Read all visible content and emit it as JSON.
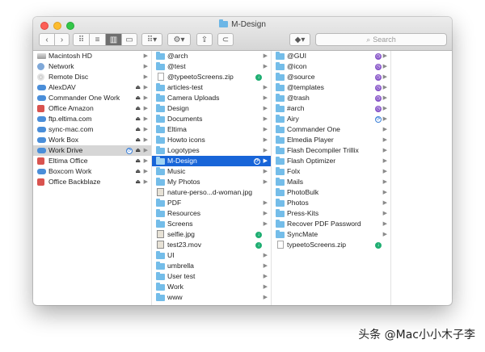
{
  "window": {
    "title": "M-Design"
  },
  "toolbar": {
    "back_icon": "chevron-left-icon",
    "forward_icon": "chevron-right-icon",
    "view_icons": [
      "icon-view-icon",
      "list-view-icon",
      "column-view-icon",
      "cover-flow-icon"
    ],
    "active_view": "column-view-icon",
    "search_placeholder": "Search"
  },
  "columns": {
    "sidebar": [
      {
        "label": "Macintosh HD",
        "icon": "drive-icon"
      },
      {
        "label": "Network",
        "icon": "network-icon"
      },
      {
        "label": "Remote Disc",
        "icon": "disc-icon"
      },
      {
        "label": "AlexDAV",
        "icon": "cloud-icon",
        "eject": "⏏"
      },
      {
        "label": "Commander One Work",
        "icon": "cloud-icon",
        "eject": "⏏"
      },
      {
        "label": "Office Amazon",
        "icon": "app-icon",
        "eject": "⏏"
      },
      {
        "label": "ftp.eltima.com",
        "icon": "cloud-icon",
        "eject": "⏏"
      },
      {
        "label": "sync-mac.com",
        "icon": "cloud-icon",
        "eject": "⏏"
      },
      {
        "label": "Work Box",
        "icon": "cloud-icon",
        "eject": "⏏"
      },
      {
        "label": "Work Drive",
        "icon": "cloud-icon",
        "eject": "⏏",
        "sync": "⟳",
        "selected": true
      },
      {
        "label": "Eltima Office",
        "icon": "app-icon",
        "eject": "⏏"
      },
      {
        "label": "Boxcom Work",
        "icon": "cloud-icon",
        "eject": "⏏"
      },
      {
        "label": "Office Backblaze",
        "icon": "app-icon",
        "eject": "⏏"
      }
    ],
    "col2": [
      {
        "label": "@arch",
        "type": "folder"
      },
      {
        "label": "@test",
        "type": "folder"
      },
      {
        "label": "@typeetoScreens.zip",
        "type": "file",
        "status": "↓"
      },
      {
        "label": "articles-test",
        "type": "folder"
      },
      {
        "label": "Camera Uploads",
        "type": "folder"
      },
      {
        "label": "Design",
        "type": "folder"
      },
      {
        "label": "Documents",
        "type": "folder"
      },
      {
        "label": "Eltima",
        "type": "folder"
      },
      {
        "label": "Howto icons",
        "type": "folder"
      },
      {
        "label": "Logotypes",
        "type": "folder"
      },
      {
        "label": "M-Design",
        "type": "folder",
        "selected": true,
        "sync": "⟳"
      },
      {
        "label": "Music",
        "type": "folder"
      },
      {
        "label": "My Photos",
        "type": "folder"
      },
      {
        "label": "nature-perso...d-woman.jpg",
        "type": "image"
      },
      {
        "label": "PDF",
        "type": "folder"
      },
      {
        "label": "Resources",
        "type": "folder"
      },
      {
        "label": "Screens",
        "type": "folder"
      },
      {
        "label": "selfie.jpg",
        "type": "image",
        "status": "↓"
      },
      {
        "label": "test23.mov",
        "type": "image",
        "status": "↓"
      },
      {
        "label": "UI",
        "type": "folder"
      },
      {
        "label": "umbrella",
        "type": "folder"
      },
      {
        "label": "User test",
        "type": "folder"
      },
      {
        "label": "Work",
        "type": "folder"
      },
      {
        "label": "www",
        "type": "folder"
      }
    ],
    "col3": [
      {
        "label": "@GUI",
        "type": "folder",
        "clock": "◷"
      },
      {
        "label": "@icon",
        "type": "folder",
        "clock": "◷"
      },
      {
        "label": "@source",
        "type": "folder",
        "clock": "◷"
      },
      {
        "label": "@templates",
        "type": "folder",
        "clock": "◷"
      },
      {
        "label": "@trash",
        "type": "folder",
        "clock": "◷"
      },
      {
        "label": "#arch",
        "type": "folder",
        "clock": "◷"
      },
      {
        "label": "Airy",
        "type": "folder",
        "sync": "⟳"
      },
      {
        "label": "Commander One",
        "type": "folder"
      },
      {
        "label": "Elmedia Player",
        "type": "folder"
      },
      {
        "label": "Flash Decompiler Trillix",
        "type": "folder"
      },
      {
        "label": "Flash Optimizer",
        "type": "folder"
      },
      {
        "label": "Folx",
        "type": "folder"
      },
      {
        "label": "Mails",
        "type": "folder"
      },
      {
        "label": "PhotoBulk",
        "type": "folder"
      },
      {
        "label": "Photos",
        "type": "folder"
      },
      {
        "label": "Press-Kits",
        "type": "folder"
      },
      {
        "label": "Recover PDF Password",
        "type": "folder"
      },
      {
        "label": "SyncMate",
        "type": "folder"
      },
      {
        "label": "typeetoScreens.zip",
        "type": "file",
        "status": "↓"
      }
    ]
  },
  "colors": {
    "selection": "#1865d8",
    "folder": "#74bde9",
    "download_badge": "#1fae72",
    "pending_badge": "#8654c8"
  },
  "watermark": "头条 @Mac小小木子李"
}
